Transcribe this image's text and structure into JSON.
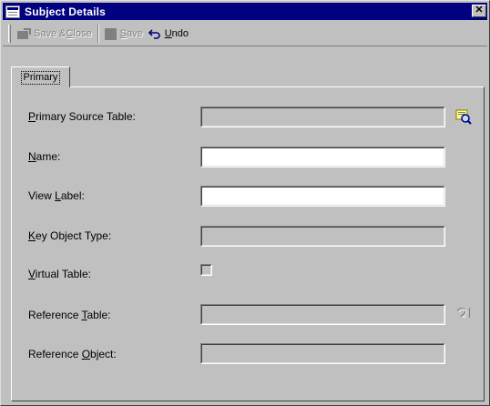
{
  "window": {
    "title": "Subject Details",
    "close_glyph": "✕",
    "icon": "table-icon"
  },
  "toolbar": {
    "save_close": {
      "prefix": "Save & ",
      "mnemonic": "C",
      "suffix": "lose",
      "enabled": false
    },
    "save": {
      "mnemonic": "S",
      "suffix": "ave",
      "enabled": false
    },
    "undo": {
      "mnemonic": "U",
      "suffix": "ndo",
      "enabled": true
    }
  },
  "tabs": [
    {
      "label": "Primary",
      "active": true
    }
  ],
  "form": {
    "primary_source_table": {
      "mnemonic": "P",
      "rest": "rimary Source Table:",
      "value": "",
      "editable": false
    },
    "name": {
      "mnemonic": "N",
      "rest": "ame:",
      "value": "",
      "editable": true
    },
    "view_label": {
      "pre": "View ",
      "mnemonic": "L",
      "rest": "abel:",
      "value": "",
      "editable": true
    },
    "key_object_type": {
      "mnemonic": "K",
      "rest": "ey Object Type:",
      "value": "",
      "editable": false
    },
    "virtual_table": {
      "mnemonic": "V",
      "rest": "irtual Table:",
      "checked": false
    },
    "reference_table": {
      "pre": "Reference ",
      "mnemonic": "T",
      "rest": "able:",
      "value": "",
      "editable": false
    },
    "reference_object": {
      "pre": "Reference ",
      "mnemonic": "O",
      "rest": "bject:",
      "value": "",
      "editable": false
    }
  },
  "colors": {
    "face": "#c0c0c0",
    "titlebar": "#000080",
    "disabled_text": "#808080"
  }
}
